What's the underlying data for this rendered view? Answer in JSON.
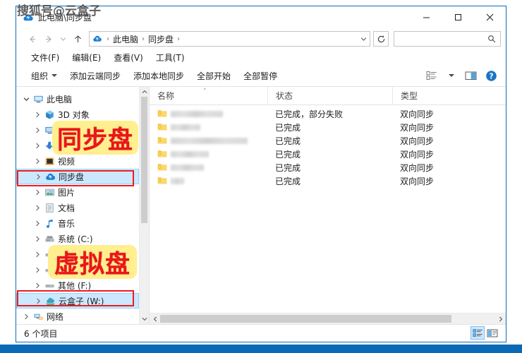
{
  "watermark": "搜狐号@云盒子",
  "window": {
    "title": "此电脑\\同步盘",
    "title_icon": "cloud-sync-icon",
    "controls": {
      "minimize": "─",
      "maximize": "□",
      "close": "✕"
    }
  },
  "nav": {
    "back": "←",
    "forward": "→",
    "recent": "⌄",
    "up": "↑",
    "refresh": "↻",
    "address_icon": "cloud-sync-icon",
    "breadcrumbs": [
      "此电脑",
      "同步盘"
    ],
    "separator": "›",
    "dropdown": "⌄"
  },
  "search": {
    "value": "",
    "placeholder": "",
    "icon": "search-icon"
  },
  "menubar": {
    "items": [
      {
        "label": "文件(F)",
        "name": "menu-file"
      },
      {
        "label": "编辑(E)",
        "name": "menu-edit"
      },
      {
        "label": "查看(V)",
        "name": "menu-view"
      },
      {
        "label": "工具(T)",
        "name": "menu-tools"
      }
    ]
  },
  "toolbar": {
    "organize": "组织",
    "add_cloud_sync": "添加云端同步",
    "add_local_sync": "添加本地同步",
    "start_all": "全部开始",
    "pause_all": "全部暂停",
    "view_options_icon": "view-layout-icon",
    "view_options_caret": "▼",
    "preview_pane_icon": "preview-pane-icon",
    "help_icon": "help-icon"
  },
  "sidebar": {
    "items": [
      {
        "label": "此电脑",
        "icon": "computer-icon",
        "indent": 0,
        "expander": "open",
        "selected": false
      },
      {
        "label": "3D 对象",
        "icon": "3d-objects-icon",
        "indent": 1,
        "expander": "closed",
        "selected": false
      },
      {
        "label": "桌面",
        "icon": "desktop-icon",
        "indent": 1,
        "expander": "closed",
        "selected": false,
        "truncated": "D"
      },
      {
        "label": "下载",
        "icon": "downloads-icon",
        "indent": 1,
        "expander": "closed",
        "selected": false,
        "truncated": "D"
      },
      {
        "label": "视频",
        "icon": "videos-icon",
        "indent": 1,
        "expander": "closed",
        "selected": false
      },
      {
        "label": "同步盘",
        "icon": "cloud-sync-icon",
        "indent": 1,
        "expander": "closed",
        "selected": true
      },
      {
        "label": "图片",
        "icon": "pictures-icon",
        "indent": 1,
        "expander": "closed",
        "selected": false
      },
      {
        "label": "文档",
        "icon": "documents-icon",
        "indent": 1,
        "expander": "closed",
        "selected": false
      },
      {
        "label": "音乐",
        "icon": "music-icon",
        "indent": 1,
        "expander": "closed",
        "selected": false
      },
      {
        "label": "系统 (C:)",
        "icon": "system-drive-icon",
        "indent": 1,
        "expander": "closed",
        "selected": false
      },
      {
        "label": "",
        "icon": "drive-icon",
        "indent": 1,
        "expander": "closed",
        "selected": false
      },
      {
        "label": "",
        "icon": "drive-icon",
        "indent": 1,
        "expander": "closed",
        "selected": false
      },
      {
        "label": "其他 (F:)",
        "icon": "drive-icon",
        "indent": 1,
        "expander": "closed",
        "selected": false
      },
      {
        "label": "云盒子 (W:)",
        "icon": "cloudbox-drive-icon",
        "indent": 1,
        "expander": "closed",
        "selected": true
      },
      {
        "label": "网络",
        "icon": "network-icon",
        "indent": 0,
        "expander": "closed",
        "selected": false
      }
    ],
    "scroll_up": "▲",
    "scroll_down": "▼"
  },
  "filelist": {
    "columns": [
      {
        "label": "名称",
        "name": "column-name",
        "sorted": "asc",
        "sort_glyph": "˄"
      },
      {
        "label": "状态",
        "name": "column-status",
        "sorted": ""
      },
      {
        "label": "类型",
        "name": "column-type",
        "sorted": ""
      }
    ],
    "rows": [
      {
        "name": "",
        "name_redacted_width": 74,
        "status": "已完成，部分失败",
        "type": "双向同步",
        "icon": "sync-folder-icon"
      },
      {
        "name": "",
        "name_redacted_width": 42,
        "status": "已完成",
        "type": "双向同步",
        "icon": "sync-folder-icon"
      },
      {
        "name": "",
        "name_redacted_width": 109,
        "status": "已完成",
        "type": "双向同步",
        "icon": "sync-folder-icon"
      },
      {
        "name": "",
        "name_redacted_width": 54,
        "status": "已完成",
        "type": "双向同步",
        "icon": "sync-folder-icon"
      },
      {
        "name": "",
        "name_redacted_width": 47,
        "status": "已完成",
        "type": "双向同步",
        "icon": "sync-folder-icon"
      },
      {
        "name": "",
        "name_redacted_width": 19,
        "status": "已完成",
        "type": "双向同步",
        "icon": "sync-folder-icon"
      }
    ],
    "hscroll": {
      "left": "‹",
      "right": "›"
    }
  },
  "statusbar": {
    "item_count": "6 个项目",
    "details_view_icon": "details-view-icon",
    "large_icons_view_icon": "large-icons-view-icon"
  },
  "annotations": [
    {
      "text": "同步盘",
      "name": "annotation-sync-disk"
    },
    {
      "text": "虚拟盘",
      "name": "annotation-virtual-disk"
    }
  ],
  "colors": {
    "accent": "#0a69b5",
    "window_border": "#0b6ebd",
    "selection": "#cce8ff",
    "annotation_red": "#ee1c1c",
    "annotation_highlight": "#ffef8f",
    "folder_yellow": "#f7c948"
  }
}
